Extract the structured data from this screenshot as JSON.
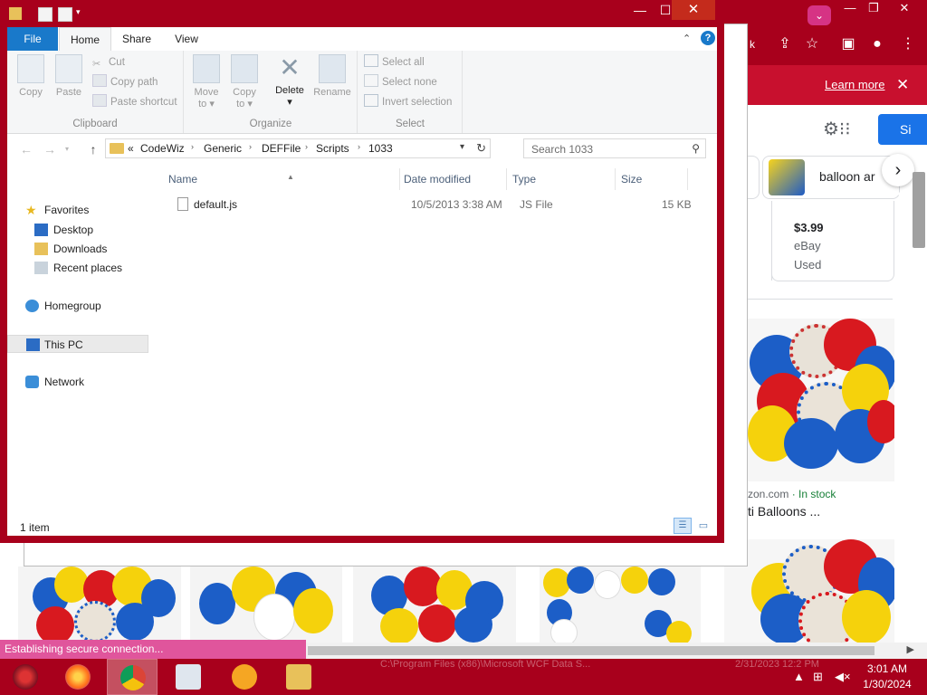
{
  "chrome": {
    "learn_more": "Learn more",
    "signin_label": "Si",
    "chip_label": "balloon ar",
    "product_price": "$3.99",
    "product_seller": "eBay",
    "product_condition": "Used",
    "store_name": "zon.com",
    "store_stock": " · In stock",
    "product_title": "ti Balloons ...",
    "status_bubble": "Establishing secure connection..."
  },
  "explorer": {
    "ribbon_tabs": [
      "File",
      "Home",
      "Share",
      "View"
    ],
    "clipboard": {
      "label": "Clipboard",
      "copy": "Copy",
      "paste": "Paste",
      "cut": "Cut",
      "copy_path": "Copy path",
      "paste_shortcut": "Paste shortcut"
    },
    "organize": {
      "label": "Organize",
      "move_to": "Move",
      "move_to_2": "to",
      "copy_to": "Copy",
      "copy_to_2": "to",
      "delete": "Delete",
      "rename": "Rename"
    },
    "select": {
      "label": "Select",
      "select_all": "Select all",
      "select_none": "Select none",
      "invert_selection": "Invert selection"
    },
    "address": {
      "overflow": "«",
      "crumbs": [
        "CodeWiz",
        "Generic",
        "DEFFile",
        "Scripts",
        "1033"
      ]
    },
    "search_placeholder": "Search 1033",
    "nav": {
      "favorites": "Favorites",
      "desktop": "Desktop",
      "downloads": "Downloads",
      "recent_places": "Recent places",
      "homegroup": "Homegroup",
      "this_pc": "This PC",
      "network": "Network"
    },
    "columns": {
      "name": "Name",
      "date_modified": "Date modified",
      "type": "Type",
      "size": "Size"
    },
    "files": [
      {
        "name": "default.js",
        "date_modified": "10/5/2013 3:38 AM",
        "type": "JS File",
        "size": "15 KB"
      }
    ],
    "item_count": "1 item"
  },
  "taskbar": {
    "ghost_text": "C:\\Program Files (x86)\\Microsoft WCF Data S...",
    "ghost_text_2": "2/31/2023 12:2 PM",
    "time": "3:01 AM",
    "date": "1/30/2024"
  },
  "colors": {
    "window_frame": "#a8001c",
    "accent": "#1979ca"
  }
}
